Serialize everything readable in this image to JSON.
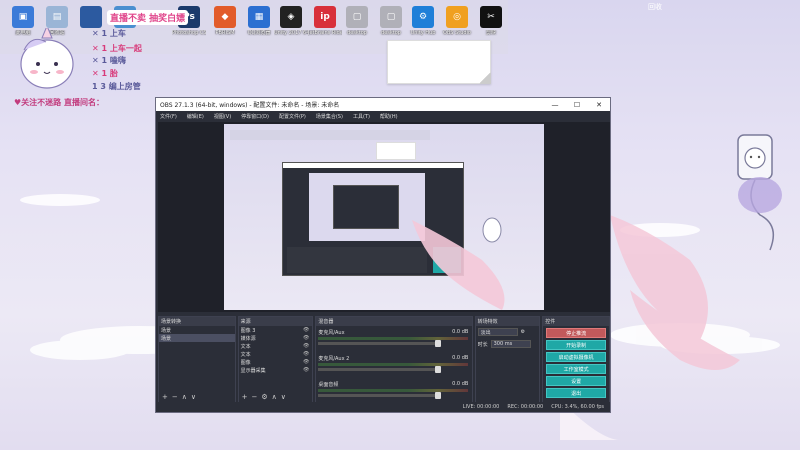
{
  "desktop": {
    "icons": [
      {
        "label": "此电脑",
        "color": "#3b7bd8",
        "glyph": "▣"
      },
      {
        "label": "回收站",
        "color": "#9ab5d6",
        "glyph": "▤"
      },
      {
        "label": "",
        "color": "#2c5aa0",
        "glyph": ""
      },
      {
        "label": "",
        "color": "#4a8fd0",
        "glyph": ""
      },
      {
        "label": "Photoshop CS6",
        "color": "#1b3a6b",
        "glyph": "Ps"
      },
      {
        "label": "PBRISM",
        "color": "#e25b2a",
        "glyph": "◆"
      },
      {
        "label": "QQ浏览器",
        "color": "#2c6fd1",
        "glyph": "▦"
      },
      {
        "label": "Unity 2017 64-bit",
        "color": "#222222",
        "glyph": "◈"
      },
      {
        "label": "JetBrains Rider",
        "color": "#d8303a",
        "glyph": "ip"
      },
      {
        "label": "desktop",
        "color": "#b0b0b8",
        "glyph": "▢"
      },
      {
        "label": "desktop",
        "color": "#b0b0b8",
        "glyph": "▢"
      },
      {
        "label": "Unity Hub",
        "color": "#1f7fd8",
        "glyph": "⚙"
      },
      {
        "label": "OBS Studio",
        "color": "#f0a020",
        "glyph": "◎"
      },
      {
        "label": "剪映",
        "color": "#111111",
        "glyph": "✂"
      }
    ],
    "top_right_label": "回收"
  },
  "overlay": {
    "title": "直播不卖 抽奖白嫖",
    "tasks": [
      {
        "icon": "✕",
        "text": "1 上车"
      },
      {
        "icon": "✕",
        "text": "1 上车一起"
      },
      {
        "icon": "✕",
        "text": "1 嗑嗨"
      },
      {
        "icon": "✕",
        "text": "1 胎"
      },
      {
        "icon": "",
        "text": "1 3 编上房管"
      }
    ],
    "bottom_text": "♥关注不迷路   直播间名："
  },
  "obs": {
    "title": "OBS 27.1.3 (64-bit, windows) - 配置文件: 未命名 - 场景: 未命名",
    "menu": [
      "文件(F)",
      "编辑(E)",
      "视图(V)",
      "停靠窗口(D)",
      "配置文件(P)",
      "场景集合(S)",
      "工具(T)",
      "帮助(H)"
    ],
    "docks": {
      "scenes": {
        "title": "场景转换",
        "header": "场景",
        "items": [
          "场景"
        ]
      },
      "sources": {
        "title": "来源",
        "items": [
          "图像 3",
          "媒体源",
          "文本",
          "文本",
          "图像",
          "显示器采集"
        ]
      },
      "mixer": {
        "title": "混音器",
        "channels": [
          {
            "name": "麦克风/Aux",
            "value": "0.0 dB"
          },
          {
            "name": "麦克风/Aux 2",
            "value": "0.0 dB"
          },
          {
            "name": "桌面音频",
            "value": "0.0 dB"
          }
        ]
      },
      "transitions": {
        "title": "转场特效",
        "type": "淡出",
        "duration_label": "时长",
        "duration": "300 ms"
      },
      "controls": {
        "title": "控件",
        "buttons": [
          "停止推流",
          "开始录制",
          "启动虚拟摄像机",
          "工作室模式",
          "设置",
          "退出"
        ]
      },
      "filter_tab": "滤镜"
    },
    "status": {
      "dropped": "LIVE: 00:00:00",
      "rec": "REC: 00:00:00",
      "cpu": "CPU: 3.4%, 60.00 fps"
    }
  }
}
